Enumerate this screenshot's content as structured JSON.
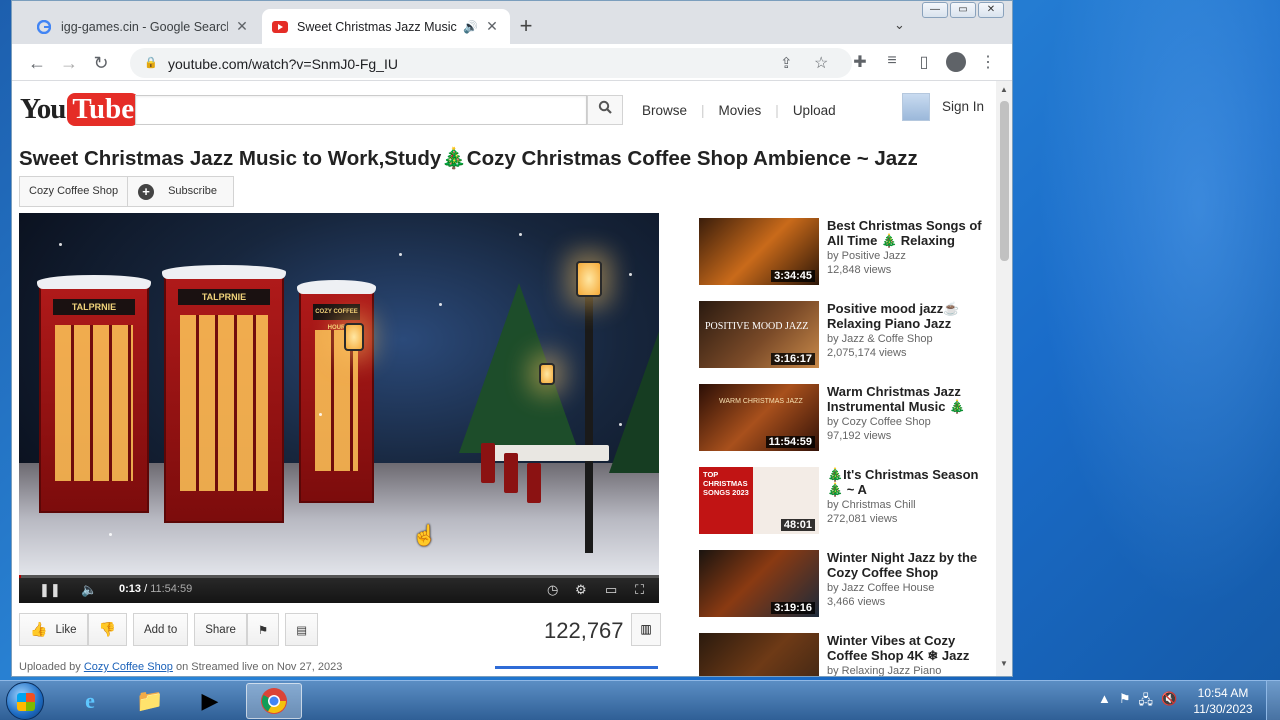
{
  "browser": {
    "tabs": [
      {
        "label": "igg-games.cin - Google Search",
        "active": false
      },
      {
        "label": "Sweet Christmas Jazz Music",
        "active": true
      }
    ],
    "address": "youtube.com/watch?v=SnmJ0-Fg_IU"
  },
  "youtube": {
    "logo_you": "You",
    "logo_tube": "Tube",
    "search_value": "",
    "nav": [
      "Browse",
      "Movies",
      "Upload"
    ],
    "sign_in": "Sign In"
  },
  "video": {
    "title": "Sweet Christmas Jazz Music to Work,Study🎄Cozy Christmas Coffee Shop Ambience ~ Jazz",
    "channel": "Cozy Coffee Shop",
    "subscribe": "Subscribe",
    "current_time": "0:13",
    "duration": "11:54:59",
    "progress": 0.0003,
    "views": "122,767",
    "actions": {
      "like": "Like",
      "add_to": "Add to",
      "share": "Share"
    },
    "uploaded_prefix": "Uploaded by",
    "uploaded_channel": "Cozy Coffee Shop",
    "uploaded_suffix": "on Streamed live on Nov 27, 2023"
  },
  "related": [
    {
      "title": "Best Christmas Songs of All Time 🎄 Relaxing",
      "by": "by Positive Jazz",
      "views": "12,848 views",
      "duration": "3:34:45",
      "thumb_text": ""
    },
    {
      "title": "Positive mood jazz☕ Relaxing Piano Jazz",
      "by": "by Jazz & Coffe Shop",
      "views": "2,075,174 views",
      "duration": "3:16:17",
      "thumb_text": "POSITIVE MOOD JAZZ"
    },
    {
      "title": "Warm Christmas Jazz Instrumental Music 🎄",
      "by": "by Cozy Coffee Shop",
      "views": "97,192 views",
      "duration": "11:54:59",
      "thumb_text": "WARM CHRISTMAS JAZZ"
    },
    {
      "title": "🎄It's Christmas Season 🎄 ~ A",
      "by": "by Christmas Chill",
      "views": "272,081 views",
      "duration": "48:01",
      "thumb_text": "TOP CHRISTMAS SONGS 2023"
    },
    {
      "title": "Winter Night Jazz by the Cozy Coffee Shop",
      "by": "by Jazz Coffee House",
      "views": "3,466 views",
      "duration": "3:19:16",
      "thumb_text": ""
    },
    {
      "title": "Winter Vibes at Cozy Coffee Shop 4K ❄ Jazz",
      "by": "by Relaxing Jazz Piano",
      "views": "",
      "duration": "",
      "thumb_text": ""
    }
  ],
  "scene_text": {
    "booth1": "TALPRNIE",
    "booth2": "TALPRNIE",
    "booth3": "COZY COFFEE HOUR"
  },
  "taskbar": {
    "time": "10:54 AM",
    "date": "11/30/2023"
  },
  "colors": {
    "yt_red": "#e52d27",
    "link_blue": "#1c62b9",
    "taskbar": "#3a6ea5"
  }
}
